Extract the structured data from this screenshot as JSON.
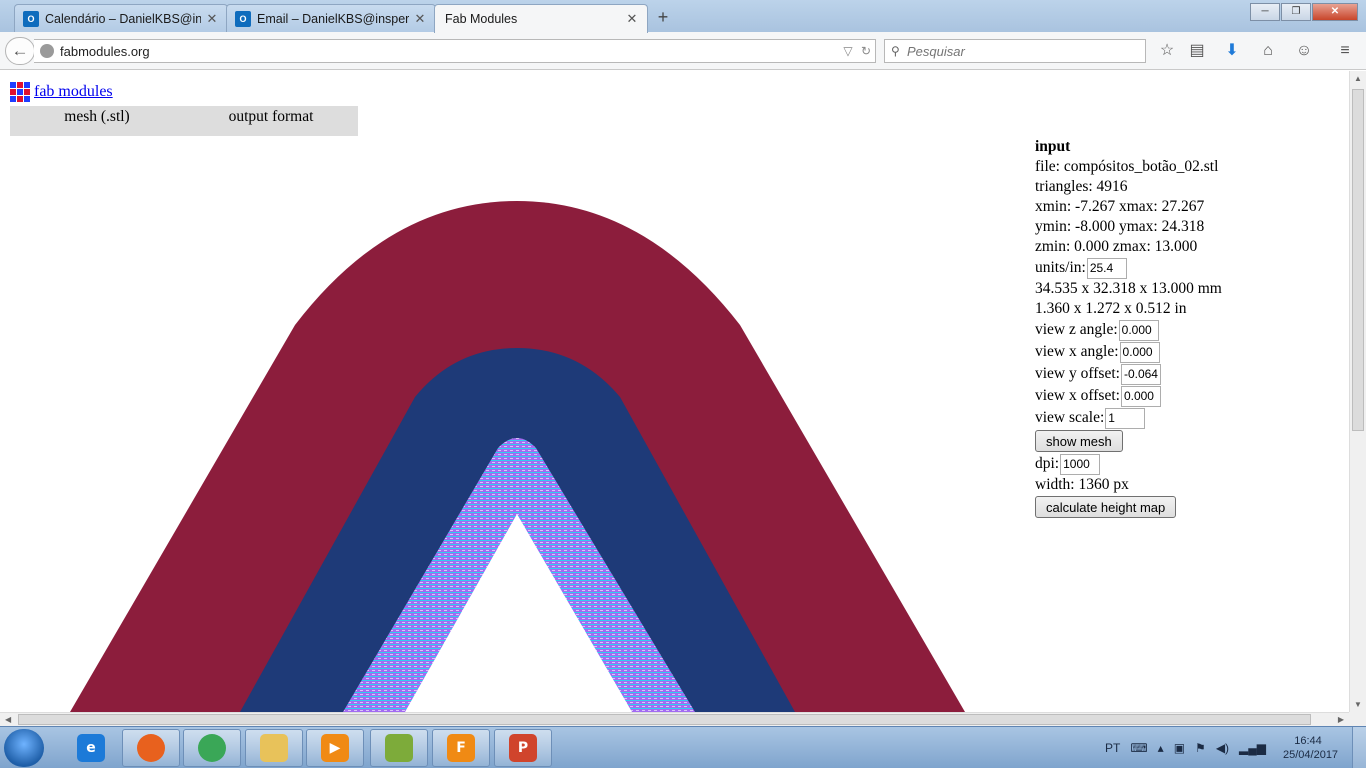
{
  "browser": {
    "tabs": [
      {
        "title": "Calendário – DanielKBS@in...",
        "icon": "outlook-icon",
        "active": false
      },
      {
        "title": "Email – DanielKBS@insper....",
        "icon": "outlook-icon",
        "active": false
      },
      {
        "title": "Fab Modules",
        "icon": "",
        "active": true
      }
    ],
    "url": "fabmodules.org",
    "search_placeholder": "Pesquisar"
  },
  "page": {
    "logo_text": "fab modules",
    "logo_colors": [
      "#1f3cff",
      "#e0102f",
      "#1f3cff",
      "#e0102f",
      "#1f3cff",
      "#e0102f",
      "#1f3cff",
      "#e0102f",
      "#1f3cff"
    ],
    "menu": [
      "mesh (.stl)",
      "output format"
    ],
    "panel": {
      "heading": "input",
      "file": "file: compósitos_botão_02.stl",
      "triangles": "triangles: 4916",
      "xrange": "xmin: -7.267 xmax: 27.267",
      "yrange": "ymin: -8.000 ymax: 24.318",
      "zrange": "zmin: 0.000 zmax: 13.000",
      "units_label": "units/in:",
      "units_value": "25.4",
      "size_mm": "34.535 x 32.318 x 13.000 mm",
      "size_in": "1.360 x 1.272 x 0.512 in",
      "z_angle_label": "view z angle:",
      "z_angle_value": "0.000",
      "x_angle_label": "view x angle:",
      "x_angle_value": "0.000",
      "y_offset_label": "view y offset:",
      "y_offset_value": "-0.064",
      "x_offset_label": "view x offset:",
      "x_offset_value": "0.000",
      "scale_label": "view scale:",
      "scale_value": "1",
      "show_mesh_button": "show mesh",
      "dpi_label": "dpi:",
      "dpi_value": "1000",
      "width_text": "width: 1360 px",
      "calc_button": "calculate height map"
    },
    "render_colors": {
      "outer": "#8c1d3c",
      "middle": "#1e3a78",
      "inner_a": "#a26bf2",
      "inner_b": "#2fd0ef"
    }
  },
  "taskbar": {
    "apps": [
      {
        "name": "internet-explorer",
        "icon": "e",
        "color": "#1c7ad8",
        "open": false
      },
      {
        "name": "firefox",
        "icon": "",
        "color": "#e8611e",
        "open": true
      },
      {
        "name": "chrome",
        "icon": "",
        "color": "#3aa757",
        "open": true
      },
      {
        "name": "file-explorer",
        "icon": "",
        "color": "#e8c25a",
        "open": true
      },
      {
        "name": "media-player",
        "icon": "▶",
        "color": "#f08a14",
        "open": true
      },
      {
        "name": "android-app",
        "icon": "",
        "color": "#7dab3a",
        "open": true
      },
      {
        "name": "fusion-360",
        "icon": "F",
        "color": "#f08a14",
        "open": true
      },
      {
        "name": "powerpoint",
        "icon": "P",
        "color": "#d0442c",
        "open": true
      }
    ],
    "language": "PT",
    "time": "16:44",
    "date": "25/04/2017"
  }
}
